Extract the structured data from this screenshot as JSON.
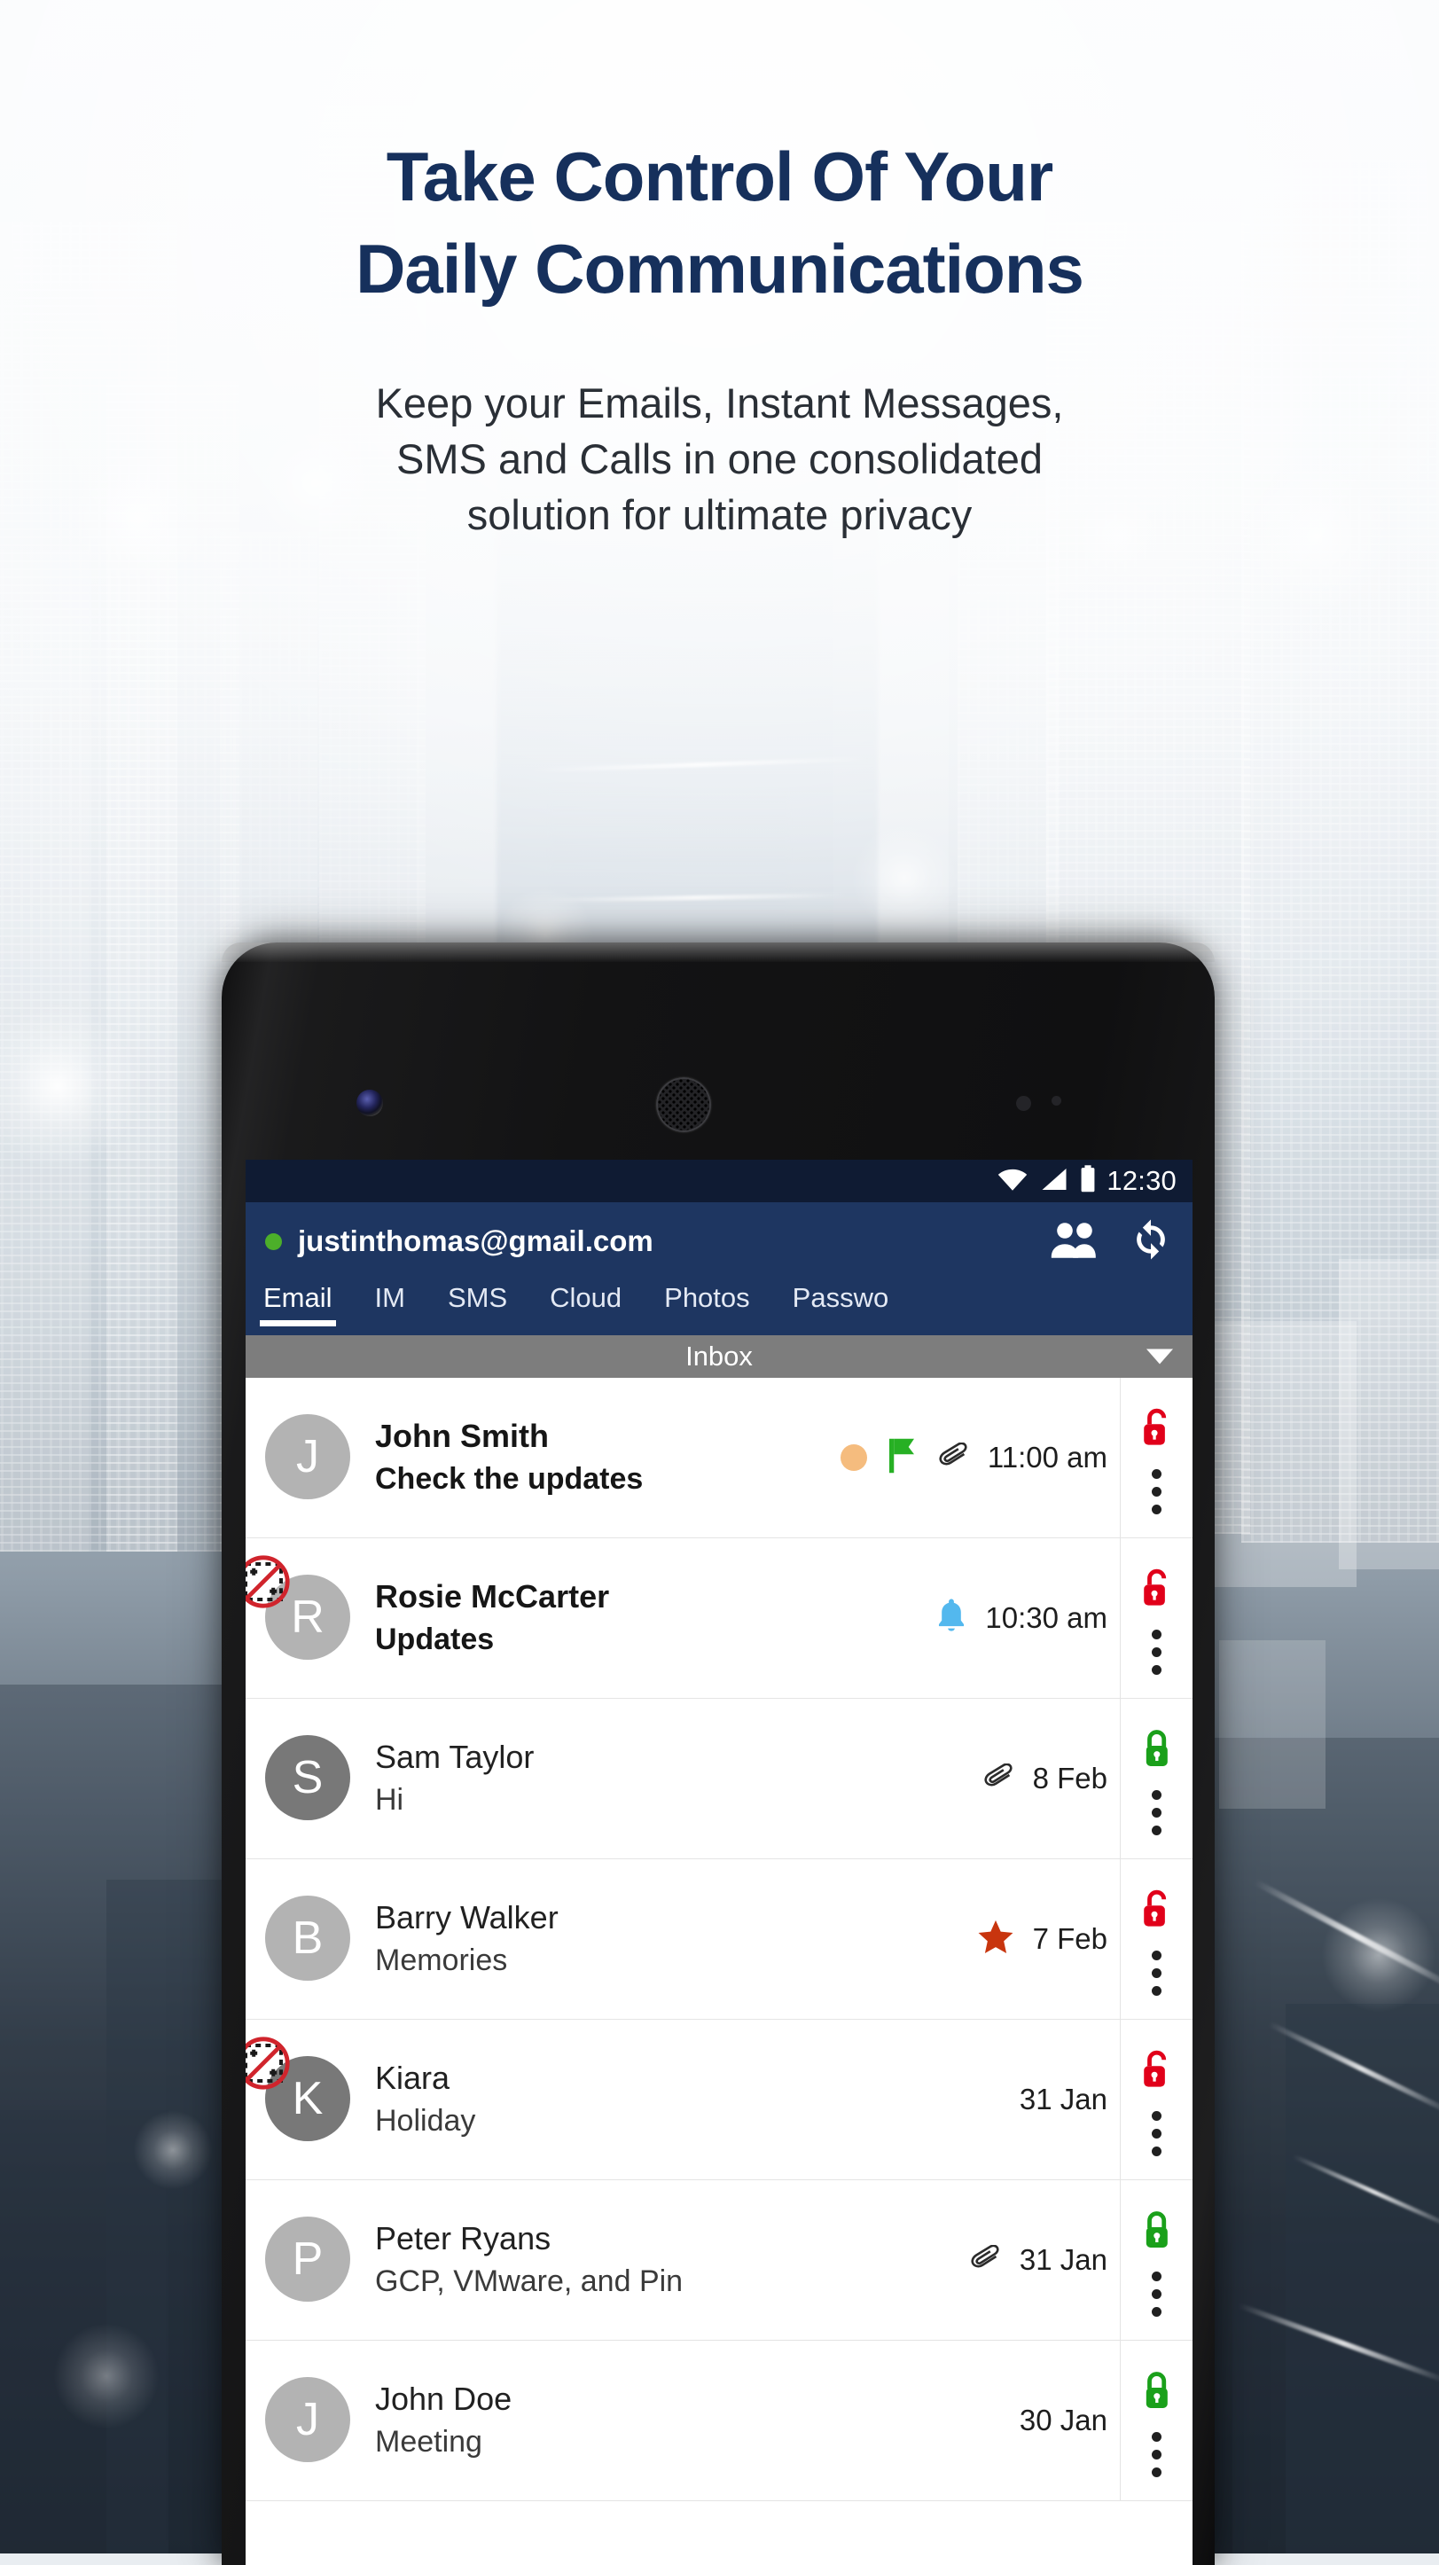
{
  "hero": {
    "headline_line1": "Take Control Of Your",
    "headline_line2": "Daily Communications",
    "sub_line1": "Keep your Emails, Instant Messages,",
    "sub_line2": "SMS and Calls in one consolidated",
    "sub_line3": "solution for ultimate privacy",
    "headline_color": "#16305c",
    "sub_color": "#2a2f36"
  },
  "phone": {
    "status_bar": {
      "time": "12:30",
      "icons": [
        "wifi-icon",
        "signal-icon",
        "battery-icon"
      ],
      "background": "#0f1b33"
    },
    "account_bar": {
      "email": "justinthomas@gmail.com",
      "online_status_color": "#4caf2a",
      "contacts_icon": "contacts-icon",
      "sync_icon": "sync-icon",
      "background": "#1e3661"
    },
    "tabs": [
      {
        "label": "Email",
        "active": true
      },
      {
        "label": "IM",
        "active": false
      },
      {
        "label": "SMS",
        "active": false
      },
      {
        "label": "Cloud",
        "active": false
      },
      {
        "label": "Photos",
        "active": false
      },
      {
        "label": "Passwo",
        "active": false
      }
    ],
    "folder_bar": {
      "name": "Inbox",
      "caret_icon": "chevron-down-icon",
      "background": "#7d7d7d"
    },
    "emails": [
      {
        "initial": "J",
        "avatar_tone": "light",
        "sender": "John Smith",
        "subject": "Check the updates",
        "date": "11:00 am",
        "unread": true,
        "blocked": false,
        "has_orange_dot": true,
        "flag": "green-flag-icon",
        "attachment": true,
        "bell": false,
        "star": false,
        "lock": "unlocked",
        "lock_color": "#e1001a"
      },
      {
        "initial": "R",
        "avatar_tone": "light",
        "sender": "Rosie McCarter",
        "subject": "Updates",
        "date": "10:30 am",
        "unread": true,
        "blocked": true,
        "has_orange_dot": false,
        "flag": null,
        "attachment": false,
        "bell": true,
        "star": false,
        "lock": "unlocked",
        "lock_color": "#e1001a"
      },
      {
        "initial": "S",
        "avatar_tone": "dark",
        "sender": "Sam Taylor",
        "subject": "Hi",
        "date": "8 Feb",
        "unread": false,
        "blocked": false,
        "has_orange_dot": false,
        "flag": null,
        "attachment": true,
        "bell": false,
        "star": false,
        "lock": "locked",
        "lock_color": "#1aa01a"
      },
      {
        "initial": "B",
        "avatar_tone": "light",
        "sender": "Barry Walker",
        "subject": "Memories",
        "date": "7 Feb",
        "unread": false,
        "blocked": false,
        "has_orange_dot": false,
        "flag": null,
        "attachment": false,
        "bell": false,
        "star": true,
        "lock": "unlocked",
        "lock_color": "#e1001a"
      },
      {
        "initial": "K",
        "avatar_tone": "dark",
        "sender": "Kiara",
        "subject": "Holiday",
        "date": "31 Jan",
        "unread": false,
        "blocked": true,
        "has_orange_dot": false,
        "flag": null,
        "attachment": false,
        "bell": false,
        "star": false,
        "lock": "unlocked",
        "lock_color": "#e1001a"
      },
      {
        "initial": "P",
        "avatar_tone": "light",
        "sender": "Peter Ryans",
        "subject": "GCP, VMware, and Pin",
        "date": "31 Jan",
        "unread": false,
        "blocked": false,
        "has_orange_dot": false,
        "flag": null,
        "attachment": true,
        "bell": false,
        "star": false,
        "lock": "locked",
        "lock_color": "#1aa01a"
      },
      {
        "initial": "J",
        "avatar_tone": "light",
        "sender": "John Doe",
        "subject": "Meeting",
        "date": "30 Jan",
        "unread": false,
        "blocked": false,
        "has_orange_dot": false,
        "flag": null,
        "attachment": false,
        "bell": false,
        "star": false,
        "lock": "locked",
        "lock_color": "#1aa01a"
      }
    ],
    "row_menu_icon": "kebab-menu-icon"
  }
}
